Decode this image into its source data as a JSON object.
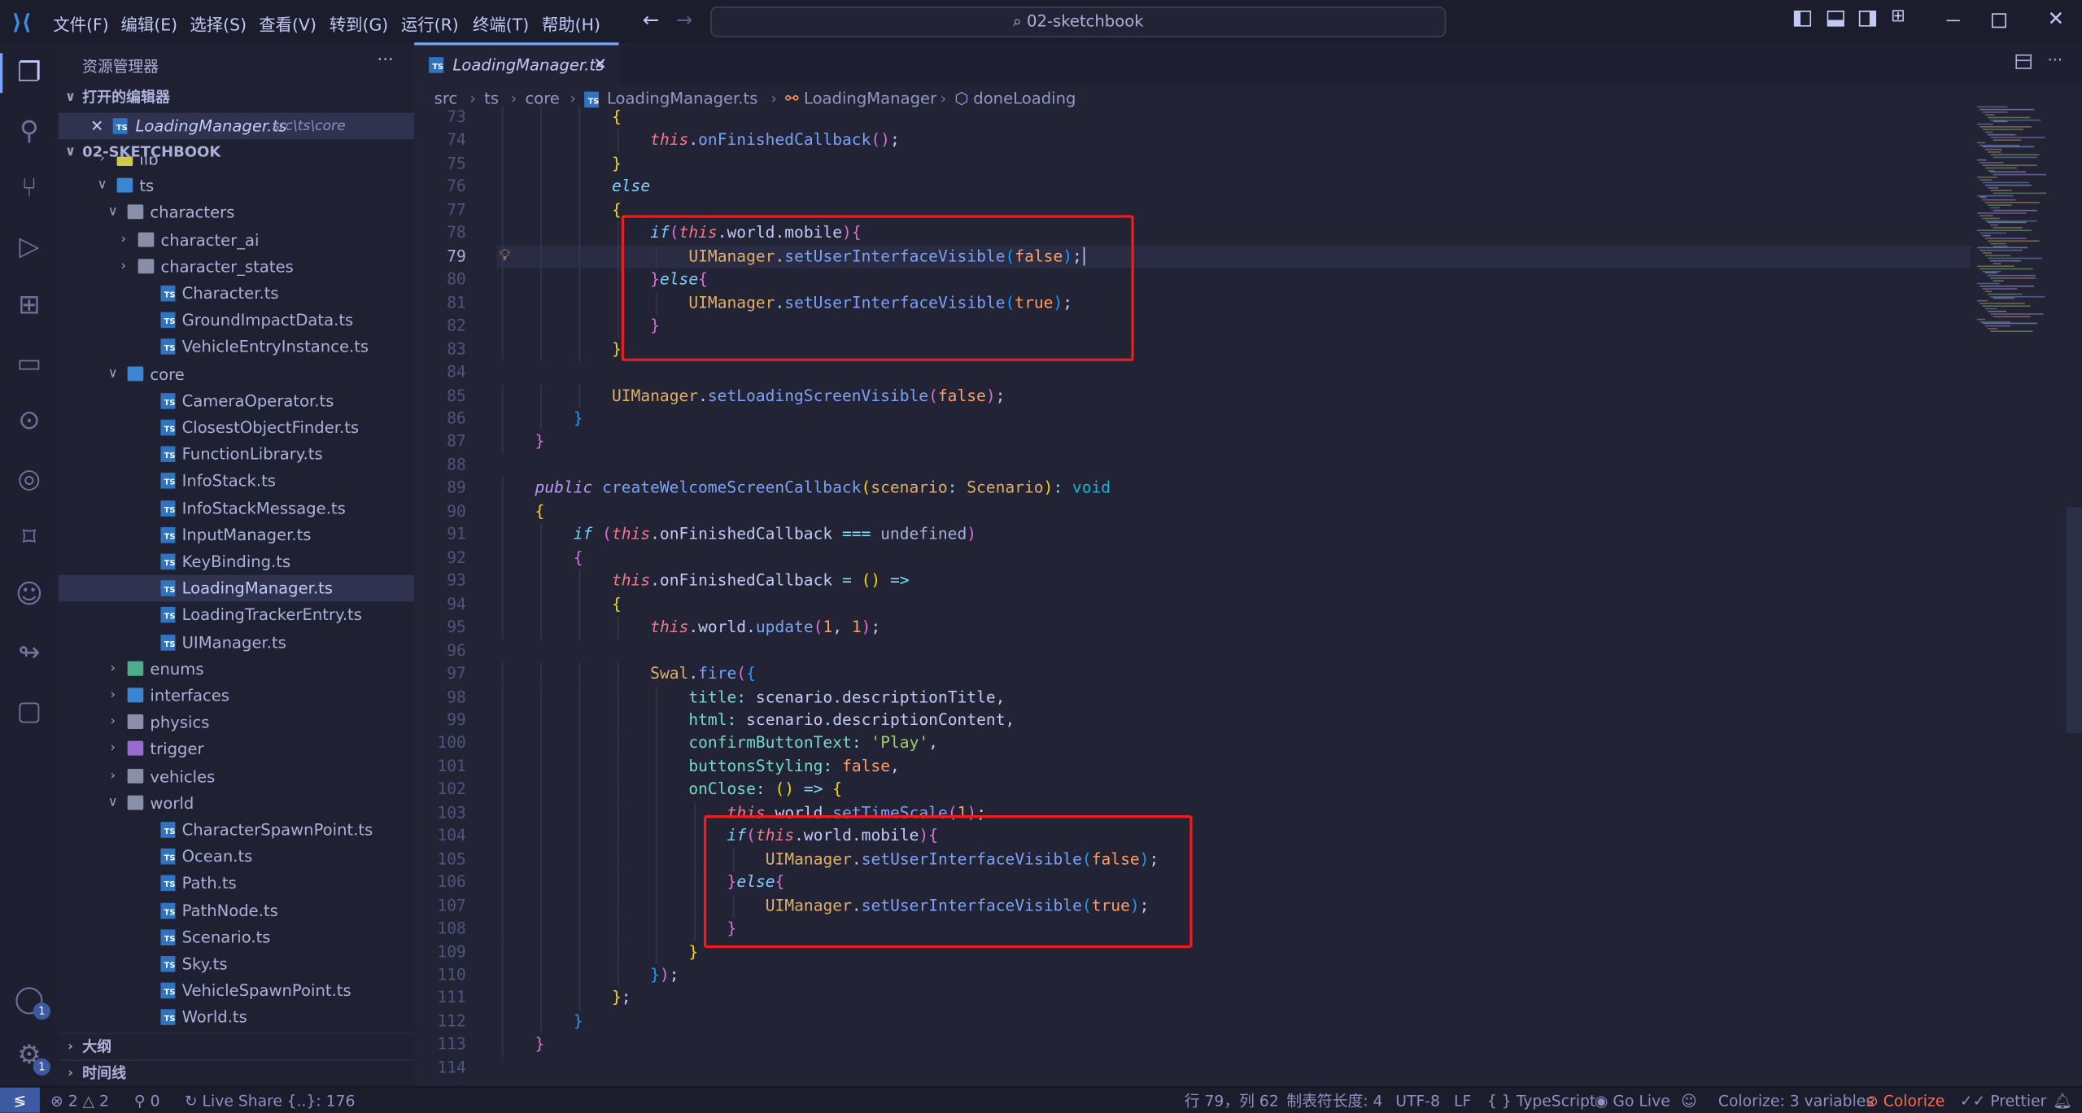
{
  "titlebar": {
    "menus": [
      "文件(F)",
      "编辑(E)",
      "选择(S)",
      "查看(V)",
      "转到(G)",
      "运行(R)",
      "终端(T)",
      "帮助(H)"
    ],
    "search": "02-sketchbook"
  },
  "activity": [
    "explorer",
    "search",
    "source-control",
    "run-debug",
    "extensions",
    "folder",
    "git-graph",
    "edge",
    "bookmark",
    "copilot",
    "live-share",
    "chat"
  ],
  "activity_badges": {
    "account": "1",
    "settings": "1"
  },
  "sidebar": {
    "title": "资源管理器",
    "more": "···",
    "open_editors_header": "打开的编辑器",
    "open_editor": {
      "name": "LoadingManager.ts",
      "path": "src\\ts\\core"
    },
    "project_header": "02-SKETCHBOOK",
    "tree": [
      {
        "label": "lib",
        "level": 1,
        "kind": "folder",
        "open": false,
        "color": "#d4c84a"
      },
      {
        "label": "ts",
        "level": 1,
        "kind": "folder",
        "open": true,
        "color": "#3a86d4"
      },
      {
        "label": "characters",
        "level": 2,
        "kind": "folder",
        "open": true,
        "color": "#8a8fa8"
      },
      {
        "label": "character_ai",
        "level": 3,
        "kind": "folder",
        "open": false,
        "color": "#8a8fa8"
      },
      {
        "label": "character_states",
        "level": 3,
        "kind": "folder",
        "open": false,
        "color": "#8a8fa8"
      },
      {
        "label": "Character.ts",
        "level": 3,
        "kind": "ts"
      },
      {
        "label": "GroundImpactData.ts",
        "level": 3,
        "kind": "ts"
      },
      {
        "label": "VehicleEntryInstance.ts",
        "level": 3,
        "kind": "ts"
      },
      {
        "label": "core",
        "level": 2,
        "kind": "folder",
        "open": true,
        "color": "#3a86d4"
      },
      {
        "label": "CameraOperator.ts",
        "level": 3,
        "kind": "ts"
      },
      {
        "label": "ClosestObjectFinder.ts",
        "level": 3,
        "kind": "ts"
      },
      {
        "label": "FunctionLibrary.ts",
        "level": 3,
        "kind": "ts"
      },
      {
        "label": "InfoStack.ts",
        "level": 3,
        "kind": "ts"
      },
      {
        "label": "InfoStackMessage.ts",
        "level": 3,
        "kind": "ts"
      },
      {
        "label": "InputManager.ts",
        "level": 3,
        "kind": "ts"
      },
      {
        "label": "KeyBinding.ts",
        "level": 3,
        "kind": "ts"
      },
      {
        "label": "LoadingManager.ts",
        "level": 3,
        "kind": "ts",
        "selected": true
      },
      {
        "label": "LoadingTrackerEntry.ts",
        "level": 3,
        "kind": "ts"
      },
      {
        "label": "UIManager.ts",
        "level": 3,
        "kind": "ts"
      },
      {
        "label": "enums",
        "level": 2,
        "kind": "folder",
        "open": false,
        "color": "#4cae8a"
      },
      {
        "label": "interfaces",
        "level": 2,
        "kind": "folder",
        "open": false,
        "color": "#3a86d4"
      },
      {
        "label": "physics",
        "level": 2,
        "kind": "folder",
        "open": false,
        "color": "#8a8fa8"
      },
      {
        "label": "trigger",
        "level": 2,
        "kind": "folder",
        "open": false,
        "color": "#9b6ad1"
      },
      {
        "label": "vehicles",
        "level": 2,
        "kind": "folder",
        "open": false,
        "color": "#8a8fa8"
      },
      {
        "label": "world",
        "level": 2,
        "kind": "folder",
        "open": true,
        "color": "#8a8fa8"
      },
      {
        "label": "CharacterSpawnPoint.ts",
        "level": 3,
        "kind": "ts"
      },
      {
        "label": "Ocean.ts",
        "level": 3,
        "kind": "ts"
      },
      {
        "label": "Path.ts",
        "level": 3,
        "kind": "ts"
      },
      {
        "label": "PathNode.ts",
        "level": 3,
        "kind": "ts"
      },
      {
        "label": "Scenario.ts",
        "level": 3,
        "kind": "ts"
      },
      {
        "label": "Sky.ts",
        "level": 3,
        "kind": "ts"
      },
      {
        "label": "VehicleSpawnPoint.ts",
        "level": 3,
        "kind": "ts"
      },
      {
        "label": "World.ts",
        "level": 3,
        "kind": "ts"
      }
    ],
    "outline": "大纲",
    "timeline": "时间线"
  },
  "editor": {
    "tab": "LoadingManager.ts",
    "breadcrumbs": [
      "src",
      "ts",
      "core",
      "LoadingManager.ts",
      "LoadingManager",
      "doneLoading"
    ],
    "current_line": 79,
    "lines": [
      {
        "n": 73,
        "i": 3,
        "t": [
          [
            "{",
            "y"
          ]
        ]
      },
      {
        "n": 74,
        "i": 4,
        "t": [
          [
            "this",
            "this"
          ],
          [
            ".",
            "p"
          ],
          [
            "onFinishedCallback",
            "fn"
          ],
          [
            "(",
            "m"
          ],
          [
            ")",
            "m"
          ],
          [
            ";",
            "p"
          ]
        ]
      },
      {
        "n": 75,
        "i": 3,
        "t": [
          [
            "}",
            "y"
          ]
        ]
      },
      {
        "n": 76,
        "i": 3,
        "t": [
          [
            "else",
            "kw"
          ]
        ]
      },
      {
        "n": 77,
        "i": 3,
        "t": [
          [
            "{",
            "y"
          ]
        ]
      },
      {
        "n": 78,
        "i": 4,
        "t": [
          [
            "if",
            "kw"
          ],
          [
            "(",
            "m"
          ],
          [
            "this",
            "this"
          ],
          [
            ".world.mobile",
            "id"
          ],
          [
            ")",
            "m"
          ],
          [
            "{",
            "m"
          ]
        ]
      },
      {
        "n": 79,
        "i": 5,
        "t": [
          [
            "UIManager",
            "cls"
          ],
          [
            ".",
            "p"
          ],
          [
            "setUserInterfaceVisible",
            "fn"
          ],
          [
            "(",
            "b"
          ],
          [
            "false",
            "bool"
          ],
          [
            ")",
            "b"
          ],
          [
            ";",
            "p"
          ]
        ]
      },
      {
        "n": 80,
        "i": 4,
        "t": [
          [
            "}",
            "m"
          ],
          [
            "else",
            "kw"
          ],
          [
            "{",
            "m"
          ]
        ]
      },
      {
        "n": 81,
        "i": 5,
        "t": [
          [
            "UIManager",
            "cls"
          ],
          [
            ".",
            "p"
          ],
          [
            "setUserInterfaceVisible",
            "fn"
          ],
          [
            "(",
            "b"
          ],
          [
            "true",
            "bool"
          ],
          [
            ")",
            "b"
          ],
          [
            ";",
            "p"
          ]
        ]
      },
      {
        "n": 82,
        "i": 4,
        "t": [
          [
            "}",
            "m"
          ]
        ]
      },
      {
        "n": 83,
        "i": 3,
        "t": [
          [
            "}",
            "y"
          ]
        ]
      },
      {
        "n": 84,
        "i": 0,
        "t": []
      },
      {
        "n": 85,
        "i": 3,
        "t": [
          [
            "UIManager",
            "cls"
          ],
          [
            ".",
            "p"
          ],
          [
            "setLoadingScreenVisible",
            "fn"
          ],
          [
            "(",
            "m"
          ],
          [
            "false",
            "bool"
          ],
          [
            ")",
            "m"
          ],
          [
            ";",
            "p"
          ]
        ]
      },
      {
        "n": 86,
        "i": 2,
        "t": [
          [
            "}",
            "b"
          ]
        ]
      },
      {
        "n": 87,
        "i": 1,
        "t": [
          [
            "}",
            "m"
          ]
        ]
      },
      {
        "n": 88,
        "i": 0,
        "t": []
      },
      {
        "n": 89,
        "i": 1,
        "t": [
          [
            "public",
            "kw2"
          ],
          [
            " ",
            "p"
          ],
          [
            "createWelcomeScreenCallback",
            "fn"
          ],
          [
            "(",
            "y"
          ],
          [
            "scenario",
            "param"
          ],
          [
            ": ",
            "op"
          ],
          [
            "Scenario",
            "cls"
          ],
          [
            ")",
            "y"
          ],
          [
            ": ",
            "op"
          ],
          [
            "void",
            "type"
          ]
        ]
      },
      {
        "n": 90,
        "i": 1,
        "t": [
          [
            "{",
            "y"
          ]
        ]
      },
      {
        "n": 91,
        "i": 2,
        "t": [
          [
            "if",
            "kw"
          ],
          [
            " ",
            "p"
          ],
          [
            "(",
            "m"
          ],
          [
            "this",
            "this"
          ],
          [
            ".",
            "p"
          ],
          [
            "onFinishedCallback",
            "id"
          ],
          [
            " === ",
            "op"
          ],
          [
            "undefined",
            "undef"
          ],
          [
            ")",
            "m"
          ]
        ]
      },
      {
        "n": 92,
        "i": 2,
        "t": [
          [
            "{",
            "m"
          ]
        ]
      },
      {
        "n": 93,
        "i": 3,
        "t": [
          [
            "this",
            "this"
          ],
          [
            ".",
            "p"
          ],
          [
            "onFinishedCallback",
            "id"
          ],
          [
            " = ",
            "op"
          ],
          [
            "()",
            "y"
          ],
          [
            " =>",
            "op"
          ]
        ]
      },
      {
        "n": 94,
        "i": 3,
        "t": [
          [
            "{",
            "y"
          ]
        ]
      },
      {
        "n": 95,
        "i": 4,
        "t": [
          [
            "this",
            "this"
          ],
          [
            ".world.",
            "p"
          ],
          [
            "update",
            "fn"
          ],
          [
            "(",
            "m"
          ],
          [
            "1",
            "num"
          ],
          [
            ", ",
            "p"
          ],
          [
            "1",
            "num"
          ],
          [
            ")",
            "m"
          ],
          [
            ";",
            "p"
          ]
        ]
      },
      {
        "n": 96,
        "i": 0,
        "t": []
      },
      {
        "n": 97,
        "i": 4,
        "t": [
          [
            "Swal",
            "cls"
          ],
          [
            ".",
            "p"
          ],
          [
            "fire",
            "fn"
          ],
          [
            "(",
            "m"
          ],
          [
            "{",
            "b"
          ]
        ]
      },
      {
        "n": 98,
        "i": 5,
        "t": [
          [
            "title",
            "prop"
          ],
          [
            ": ",
            "op"
          ],
          [
            "scenario",
            "id"
          ],
          [
            ".",
            "p"
          ],
          [
            "descriptionTitle",
            "id"
          ],
          [
            ",",
            "p"
          ]
        ]
      },
      {
        "n": 99,
        "i": 5,
        "t": [
          [
            "html",
            "prop"
          ],
          [
            ": ",
            "op"
          ],
          [
            "scenario",
            "id"
          ],
          [
            ".",
            "p"
          ],
          [
            "descriptionContent",
            "id"
          ],
          [
            ",",
            "p"
          ]
        ]
      },
      {
        "n": 100,
        "i": 5,
        "t": [
          [
            "confirmButtonText",
            "prop"
          ],
          [
            ": ",
            "op"
          ],
          [
            "'Play'",
            "str"
          ],
          [
            ",",
            "p"
          ]
        ]
      },
      {
        "n": 101,
        "i": 5,
        "t": [
          [
            "buttonsStyling",
            "prop"
          ],
          [
            ": ",
            "op"
          ],
          [
            "false",
            "bool"
          ],
          [
            ",",
            "p"
          ]
        ]
      },
      {
        "n": 102,
        "i": 5,
        "t": [
          [
            "onClose",
            "prop"
          ],
          [
            ": ",
            "op"
          ],
          [
            "()",
            "y"
          ],
          [
            " => ",
            "op"
          ],
          [
            "{",
            "y"
          ]
        ]
      },
      {
        "n": 103,
        "i": 6,
        "t": [
          [
            "this",
            "this"
          ],
          [
            ".world.",
            "p"
          ],
          [
            "setTimeScale",
            "fn"
          ],
          [
            "(",
            "m"
          ],
          [
            "1",
            "num"
          ],
          [
            ")",
            "m"
          ],
          [
            ";",
            "p"
          ]
        ]
      },
      {
        "n": 104,
        "i": 6,
        "t": [
          [
            "if",
            "kw"
          ],
          [
            "(",
            "m"
          ],
          [
            "this",
            "this"
          ],
          [
            ".world.mobile",
            "id"
          ],
          [
            ")",
            "m"
          ],
          [
            "{",
            "m"
          ]
        ]
      },
      {
        "n": 105,
        "i": 7,
        "t": [
          [
            "UIManager",
            "cls"
          ],
          [
            ".",
            "p"
          ],
          [
            "setUserInterfaceVisible",
            "fn"
          ],
          [
            "(",
            "b"
          ],
          [
            "false",
            "bool"
          ],
          [
            ")",
            "b"
          ],
          [
            ";",
            "p"
          ]
        ]
      },
      {
        "n": 106,
        "i": 6,
        "t": [
          [
            "}",
            "m"
          ],
          [
            "else",
            "kw"
          ],
          [
            "{",
            "m"
          ]
        ]
      },
      {
        "n": 107,
        "i": 7,
        "t": [
          [
            "UIManager",
            "cls"
          ],
          [
            ".",
            "p"
          ],
          [
            "setUserInterfaceVisible",
            "fn"
          ],
          [
            "(",
            "b"
          ],
          [
            "true",
            "bool"
          ],
          [
            ")",
            "b"
          ],
          [
            ";",
            "p"
          ]
        ]
      },
      {
        "n": 108,
        "i": 6,
        "t": [
          [
            "}",
            "m"
          ]
        ]
      },
      {
        "n": 109,
        "i": 5,
        "t": [
          [
            "}",
            "y"
          ]
        ]
      },
      {
        "n": 110,
        "i": 4,
        "t": [
          [
            "}",
            "b"
          ],
          [
            ")",
            "m"
          ],
          [
            ";",
            "p"
          ]
        ]
      },
      {
        "n": 111,
        "i": 3,
        "t": [
          [
            "}",
            "y"
          ],
          [
            ";",
            "p"
          ]
        ]
      },
      {
        "n": 112,
        "i": 2,
        "t": [
          [
            "}",
            "b"
          ]
        ]
      },
      {
        "n": 113,
        "i": 1,
        "t": [
          [
            "}",
            "m"
          ]
        ]
      },
      {
        "n": 114,
        "i": 0,
        "t": []
      }
    ]
  },
  "statusbar": {
    "errors": "2",
    "warnings": "2",
    "ports": "0",
    "live_share": "Live Share",
    "symbols": "{..}: 176",
    "position": "行 79，列 62",
    "indent": "制表符长度: 4",
    "encoding": "UTF-8",
    "eol": "LF",
    "language": "TypeScript",
    "go_live": "Go Live",
    "colorize_vars": "Colorize: 3 variables",
    "colorize": "Colorize",
    "prettier": "Prettier"
  },
  "colors": {
    "accent": "#7aa2f7",
    "highlight_box": "#ee1c1c",
    "remote": "#3d59a1",
    "colorize": "#ff6a4d"
  }
}
